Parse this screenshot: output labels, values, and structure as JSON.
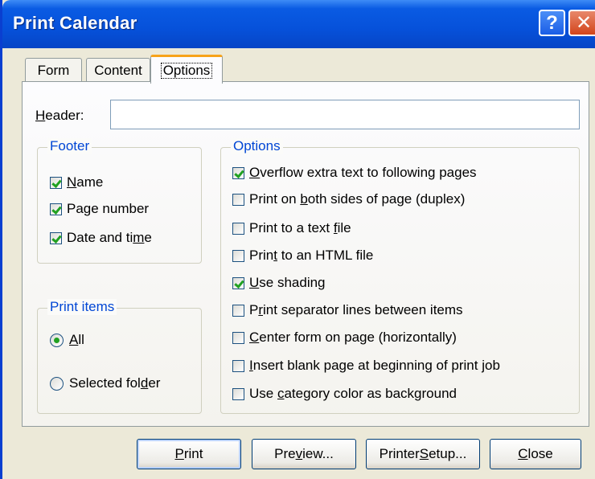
{
  "window": {
    "title": "Print Calendar"
  },
  "titlebar": {
    "help_glyph": "?",
    "close_glyph": "✕"
  },
  "tabs": [
    {
      "label": "Form",
      "selected": false
    },
    {
      "label": "Content",
      "selected": false
    },
    {
      "label": "Options",
      "selected": true
    }
  ],
  "header": {
    "label_pre": "",
    "label_ul": "H",
    "label_post": "eader:",
    "value": "",
    "placeholder": ""
  },
  "footer_group": {
    "title": "Footer",
    "items": [
      {
        "pre": "",
        "ul": "N",
        "post": "ame",
        "checked": true
      },
      {
        "pre": "Page number",
        "ul": "",
        "post": "",
        "checked": true
      },
      {
        "pre": "Date and ti",
        "ul": "m",
        "post": "e",
        "checked": true
      }
    ]
  },
  "print_items_group": {
    "title": "Print items",
    "items": [
      {
        "pre": "",
        "ul": "A",
        "post": "ll",
        "selected": true
      },
      {
        "pre": "Selected fol",
        "ul": "d",
        "post": "er",
        "selected": false
      }
    ]
  },
  "options_group": {
    "title": "Options",
    "items": [
      {
        "pre": "",
        "ul": "O",
        "post": "verflow extra text to following pages",
        "checked": true
      },
      {
        "pre": "Print on ",
        "ul": "b",
        "post": "oth sides of page (duplex)",
        "checked": false
      },
      {
        "pre": "Print to a text ",
        "ul": "f",
        "post": "ile",
        "checked": false
      },
      {
        "pre": "Prin",
        "ul": "t",
        "post": " to an HTML file",
        "checked": false
      },
      {
        "pre": "",
        "ul": "U",
        "post": "se shading",
        "checked": true
      },
      {
        "pre": "P",
        "ul": "r",
        "post": "int separator lines between items",
        "checked": false
      },
      {
        "pre": "",
        "ul": "C",
        "post": "enter form on page (horizontally)",
        "checked": false
      },
      {
        "pre": "",
        "ul": "I",
        "post": "nsert blank page at beginning of print job",
        "checked": false
      },
      {
        "pre": "Use ",
        "ul": "c",
        "post": "ategory color as background",
        "checked": false
      }
    ]
  },
  "buttons": {
    "print": {
      "pre": "",
      "ul": "P",
      "post": "rint"
    },
    "preview": {
      "pre": "Pre",
      "ul": "v",
      "post": "iew..."
    },
    "setup": {
      "pre": "Printer ",
      "ul": "S",
      "post": "etup..."
    },
    "close": {
      "pre": "",
      "ul": "C",
      "post": "lose"
    }
  },
  "colors": {
    "title_bar": "#0651da",
    "dialog_face": "#ece9d8",
    "group_title": "#0046d5",
    "check_mark": "#21a121",
    "active_tab_accent": "#f7a31a"
  }
}
